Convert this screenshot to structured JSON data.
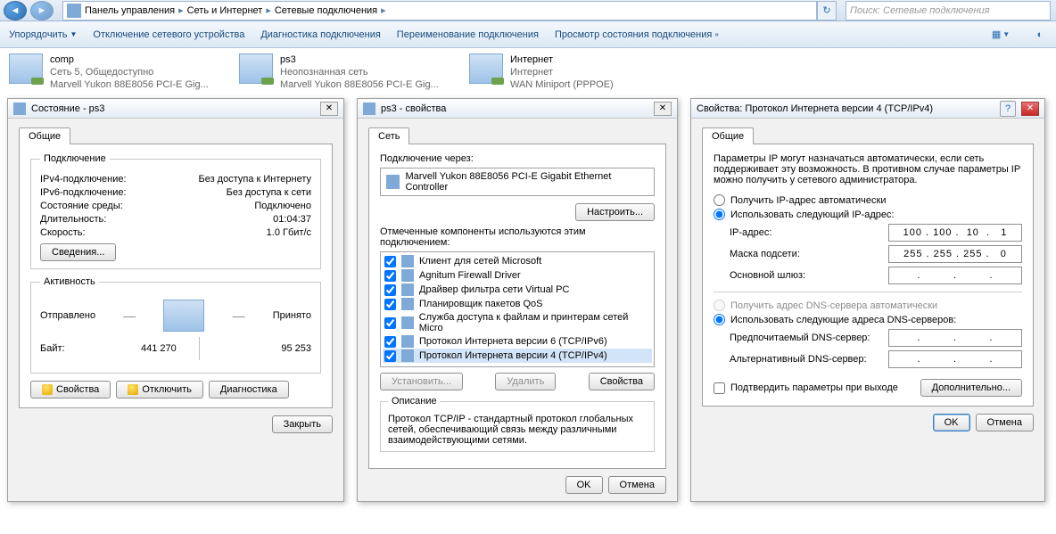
{
  "breadcrumb": {
    "a": "Панель управления",
    "b": "Сеть и Интернет",
    "c": "Сетевые подключения"
  },
  "search_placeholder": "Поиск: Сетевые подключения",
  "cmds": {
    "organize": "Упорядочить",
    "disable": "Отключение сетевого устройства",
    "diag": "Диагностика подключения",
    "rename": "Переименование подключения",
    "status": "Просмотр состояния подключения"
  },
  "conns": [
    {
      "name": "comp",
      "l2": "Сеть 5, Общедоступно",
      "l3": "Marvell Yukon 88E8056 PCI-E Gig..."
    },
    {
      "name": "ps3",
      "l2": "Неопознанная сеть",
      "l3": "Marvell Yukon 88E8056 PCI-E Gig..."
    },
    {
      "name": "Интернет",
      "l2": "Интернет",
      "l3": "WAN Miniport (PPPOE)"
    }
  ],
  "status": {
    "title": "Состояние - ps3",
    "tab": "Общие",
    "grp1": "Подключение",
    "ipv4_l": "IPv4-подключение:",
    "ipv4_v": "Без доступа к Интернету",
    "ipv6_l": "IPv6-подключение:",
    "ipv6_v": "Без доступа к сети",
    "media_l": "Состояние среды:",
    "media_v": "Подключено",
    "dur_l": "Длительность:",
    "dur_v": "01:04:37",
    "speed_l": "Скорость:",
    "speed_v": "1.0 Гбит/с",
    "details_btn": "Сведения...",
    "grp2": "Активность",
    "sent_l": "Отправлено",
    "recv_l": "Принято",
    "bytes_l": "Байт:",
    "sent_v": "441 270",
    "recv_v": "95 253",
    "props_btn": "Свойства",
    "disc_btn": "Отключить",
    "diag_btn": "Диагностика",
    "close_btn": "Закрыть"
  },
  "props": {
    "title": "ps3 - свойства",
    "tab": "Сеть",
    "conn_via": "Подключение через:",
    "adapter": "Marvell Yukon 88E8056 PCI-E Gigabit Ethernet Controller",
    "configure": "Настроить...",
    "comps_label": "Отмеченные компоненты используются этим подключением:",
    "components": [
      "Клиент для сетей Microsoft",
      "Agnitum Firewall Driver",
      "Драйвер фильтра сети Virtual PC",
      "Планировщик пакетов QoS",
      "Служба доступа к файлам и принтерам сетей Micro",
      "Протокол Интернета версии 6 (TCP/IPv6)",
      "Протокол Интернета версии 4 (TCP/IPv4)"
    ],
    "install": "Установить...",
    "remove": "Удалить",
    "properties": "Свойства",
    "desc_h": "Описание",
    "desc_t": "Протокол TCP/IP - стандартный протокол глобальных сетей, обеспечивающий связь между различными взаимодействующими сетями.",
    "ok": "OK",
    "cancel": "Отмена"
  },
  "ipv4": {
    "title": "Свойства: Протокол Интернета версии 4 (TCP/IPv4)",
    "tab": "Общие",
    "intro": "Параметры IP могут назначаться автоматически, если сеть поддерживает эту возможность. В противном случае параметры IP можно получить у сетевого администратора.",
    "r_auto_ip": "Получить IP-адрес автоматически",
    "r_use_ip": "Использовать следующий IP-адрес:",
    "ip_l": "IP-адрес:",
    "ip_v": "100 . 100 .  10  .   1",
    "mask_l": "Маска подсети:",
    "mask_v": "255 . 255 . 255 .   0",
    "gw_l": "Основной шлюз:",
    "gw_v": ".         .         .",
    "r_auto_dns": "Получить адрес DNS-сервера автоматически",
    "r_use_dns": "Использовать следующие адреса DNS-серверов:",
    "dns1_l": "Предпочитаемый DNS-сервер:",
    "dns1_v": ".         .         .",
    "dns2_l": "Альтернативный DNS-сервер:",
    "dns2_v": ".         .         .",
    "confirm": "Подтвердить параметры при выходе",
    "advanced": "Дополнительно...",
    "ok": "OK",
    "cancel": "Отмена"
  }
}
